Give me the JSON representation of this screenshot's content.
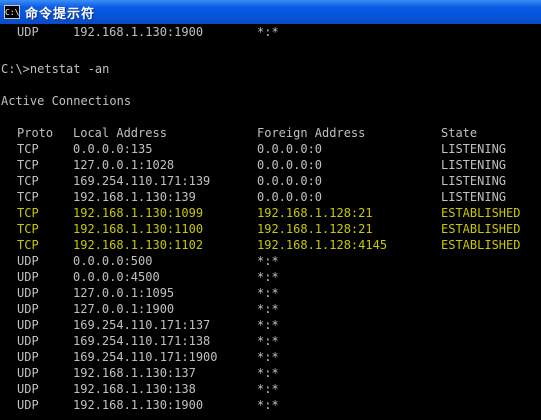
{
  "window": {
    "title": "命令提示符",
    "icon_label": "C:\\"
  },
  "console": {
    "top_row": {
      "proto": "UDP",
      "local": "192.168.1.130:1900",
      "foreign": "*:*"
    },
    "command": "C:\\>netstat -an",
    "section_title": "Active Connections",
    "headers": {
      "proto": "Proto",
      "local": "Local Address",
      "foreign": "Foreign Address",
      "state": "State"
    },
    "highlight_color": "#c8c800",
    "text_color": "#c0c0c0",
    "rows": [
      {
        "proto": "TCP",
        "local": "0.0.0.0:135",
        "foreign": "0.0.0.0:0",
        "state": "LISTENING",
        "highlight": false
      },
      {
        "proto": "TCP",
        "local": "127.0.0.1:1028",
        "foreign": "0.0.0.0:0",
        "state": "LISTENING",
        "highlight": false
      },
      {
        "proto": "TCP",
        "local": "169.254.110.171:139",
        "foreign": "0.0.0.0:0",
        "state": "LISTENING",
        "highlight": false
      },
      {
        "proto": "TCP",
        "local": "192.168.1.130:139",
        "foreign": "0.0.0.0:0",
        "state": "LISTENING",
        "highlight": false
      },
      {
        "proto": "TCP",
        "local": "192.168.1.130:1099",
        "foreign": "192.168.1.128:21",
        "state": "ESTABLISHED",
        "highlight": true
      },
      {
        "proto": "TCP",
        "local": "192.168.1.130:1100",
        "foreign": "192.168.1.128:21",
        "state": "ESTABLISHED",
        "highlight": true
      },
      {
        "proto": "TCP",
        "local": "192.168.1.130:1102",
        "foreign": "192.168.1.128:4145",
        "state": "ESTABLISHED",
        "highlight": true
      },
      {
        "proto": "UDP",
        "local": "0.0.0.0:500",
        "foreign": "*:*",
        "state": "",
        "highlight": false
      },
      {
        "proto": "UDP",
        "local": "0.0.0.0:4500",
        "foreign": "*:*",
        "state": "",
        "highlight": false
      },
      {
        "proto": "UDP",
        "local": "127.0.0.1:1095",
        "foreign": "*:*",
        "state": "",
        "highlight": false
      },
      {
        "proto": "UDP",
        "local": "127.0.0.1:1900",
        "foreign": "*:*",
        "state": "",
        "highlight": false
      },
      {
        "proto": "UDP",
        "local": "169.254.110.171:137",
        "foreign": "*:*",
        "state": "",
        "highlight": false
      },
      {
        "proto": "UDP",
        "local": "169.254.110.171:138",
        "foreign": "*:*",
        "state": "",
        "highlight": false
      },
      {
        "proto": "UDP",
        "local": "169.254.110.171:1900",
        "foreign": "*:*",
        "state": "",
        "highlight": false
      },
      {
        "proto": "UDP",
        "local": "192.168.1.130:137",
        "foreign": "*:*",
        "state": "",
        "highlight": false
      },
      {
        "proto": "UDP",
        "local": "192.168.1.130:138",
        "foreign": "*:*",
        "state": "",
        "highlight": false
      },
      {
        "proto": "UDP",
        "local": "192.168.1.130:1900",
        "foreign": "*:*",
        "state": "",
        "highlight": false
      }
    ]
  }
}
